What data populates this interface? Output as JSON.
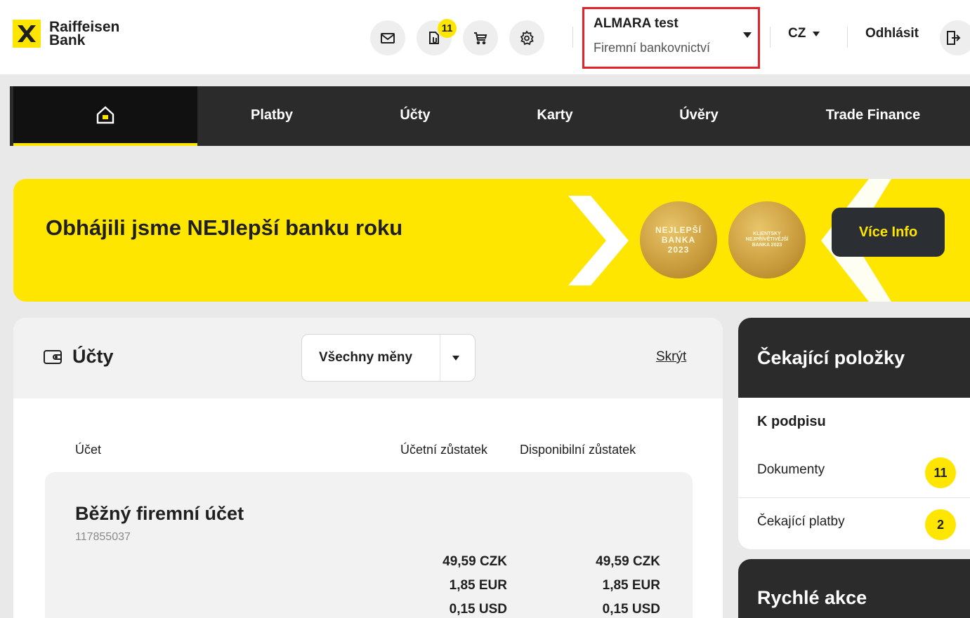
{
  "header": {
    "brand_line1": "Raiffeisen",
    "brand_line2": "Bank",
    "icons": [
      "mail-icon",
      "documents-icon",
      "cart-icon",
      "settings-icon"
    ],
    "documents_badge": "11",
    "profile": {
      "name": "ALMARA test",
      "segment": "Firemní bankovnictví"
    },
    "language": "CZ",
    "logout": "Odhlásit"
  },
  "nav": {
    "items": [
      "Platby",
      "Účty",
      "Karty",
      "Úvěry",
      "Trade Finance"
    ]
  },
  "banner": {
    "title": "Obhájili jsme NEJlepší banku roku",
    "medal1": {
      "line1": "NEJLEPŠÍ",
      "line2": "BANKA",
      "line3": "2023"
    },
    "medal2": {
      "line1": "KLIENTSKY",
      "line2": "NEJPŘÍVĚTIVĚJŠÍ",
      "line3": "BANKA 2023"
    },
    "button": "Více Info"
  },
  "accounts": {
    "title": "Účty",
    "currency_filter": "Všechny měny",
    "hide_link": "Skrýt",
    "columns": [
      "Účet",
      "Účetní zůstatek",
      "Disponibilní zůstatek"
    ],
    "rows": [
      {
        "name": "Běžný firemní účet",
        "number": "117855037",
        "accounting_balances": [
          "49,59 CZK",
          "1,85 EUR",
          "0,15 USD"
        ],
        "available_balances": [
          "49,59 CZK",
          "1,85 EUR",
          "0,15 USD"
        ]
      }
    ]
  },
  "pending": {
    "title": "Čekající položky",
    "section": "K podpisu",
    "items": [
      {
        "label": "Dokumenty",
        "count": "11"
      },
      {
        "label": "Čekající platby",
        "count": "2"
      }
    ]
  },
  "quick_actions": {
    "title": "Rychlé akce"
  },
  "colors": {
    "brand_yellow": "#fee600",
    "dark": "#2b2b2b",
    "highlight_red": "#e32129"
  }
}
